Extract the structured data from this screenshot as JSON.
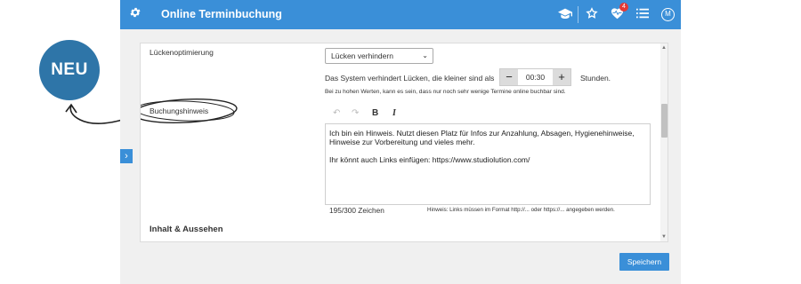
{
  "annotation": {
    "badge": "NEU"
  },
  "topbar": {
    "title": "Online Terminbuchung",
    "notification_count": "4",
    "avatar_initial": "M",
    "color": "#3a8fd8"
  },
  "form": {
    "gap_optimization": {
      "label": "Lückenoptimierung",
      "select_value": "Lücken verhindern",
      "description_prefix": "Das System verhindert Lücken, die kleiner sind als",
      "stepper_value": "00:30",
      "stepper_unit": "Stunden.",
      "warning": "Bei zu hohen Werten, kann es sein, dass nur noch sehr wenige Termine online buchbar sind."
    },
    "booking_note": {
      "label": "Buchungshinweis",
      "bold_button": "B",
      "italic_button": "I",
      "text_paragraph_1": "Ich bin ein Hinweis. Nutzt diesen Platz für Infos zur Anzahlung, Absagen, Hygienehinweise, Hinweise zur Vorbereitung und vieles mehr.",
      "text_paragraph_2": "Ihr könnt auch Links einfügen: https://www.studiolution.com/",
      "char_counter": "195/300 Zeichen",
      "link_hint": "Hinweis: Links müssen im Format http://... oder https://... angegeben werden."
    },
    "next_section": "Inhalt & Aussehen"
  },
  "actions": {
    "save_label": "Speichern"
  },
  "icons": [
    "gear-icon",
    "graduation-cap-icon",
    "star-icon",
    "heart-pulse-icon",
    "list-icon",
    "chevron-right-icon",
    "undo-icon",
    "redo-icon"
  ]
}
